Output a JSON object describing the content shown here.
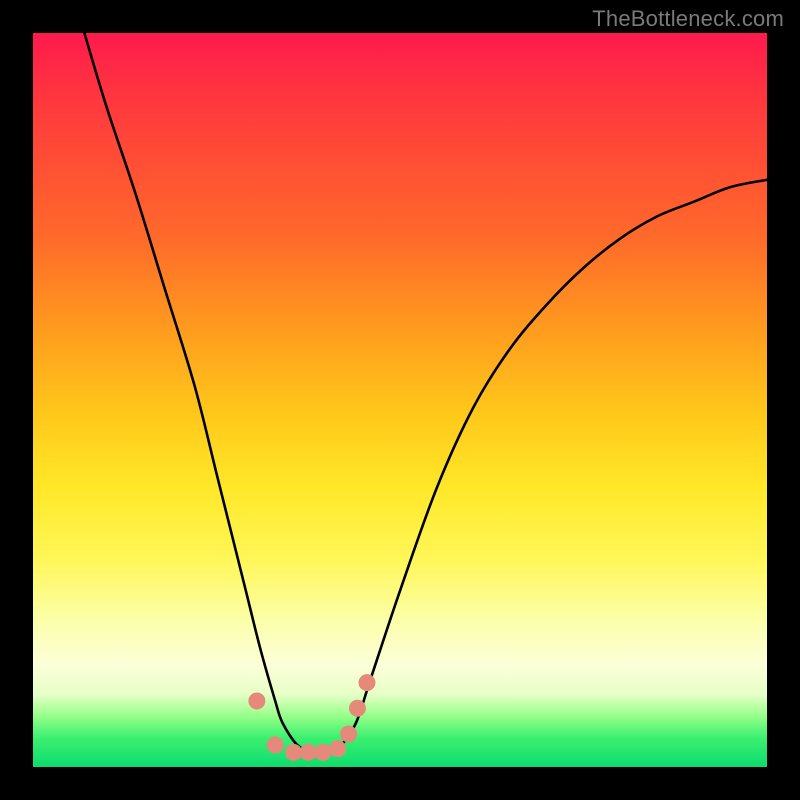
{
  "watermark": "TheBottleneck.com",
  "chart_data": {
    "type": "line",
    "title": "",
    "xlabel": "",
    "ylabel": "",
    "xlim": [
      0,
      100
    ],
    "ylim": [
      0,
      100
    ],
    "grid": false,
    "legend": false,
    "series": [
      {
        "name": "bottleneck-curve",
        "color": "#000000",
        "x": [
          7,
          10,
          14,
          18,
          22,
          25,
          27,
          29,
          31,
          33,
          34,
          36,
          38,
          40,
          42,
          44,
          46,
          50,
          55,
          60,
          65,
          70,
          75,
          80,
          85,
          90,
          95,
          100
        ],
        "y": [
          100,
          90,
          78,
          65,
          52,
          40,
          32,
          24,
          16,
          9,
          6,
          3,
          2,
          2,
          3,
          6,
          12,
          24,
          38,
          49,
          57,
          63,
          68,
          72,
          75,
          77,
          79,
          80
        ]
      }
    ],
    "points": {
      "name": "marker-dots",
      "color": "#e58a7a",
      "x": [
        30.5,
        33.0,
        35.5,
        37.5,
        39.5,
        41.5,
        43.0,
        44.2,
        45.5
      ],
      "y": [
        9.0,
        3.0,
        2.0,
        2.0,
        2.0,
        2.5,
        4.5,
        8.0,
        11.5
      ]
    },
    "background_gradient": {
      "top": "#ff1a4c",
      "mid": "#ffe828",
      "bottom": "#0ddc6e"
    }
  }
}
